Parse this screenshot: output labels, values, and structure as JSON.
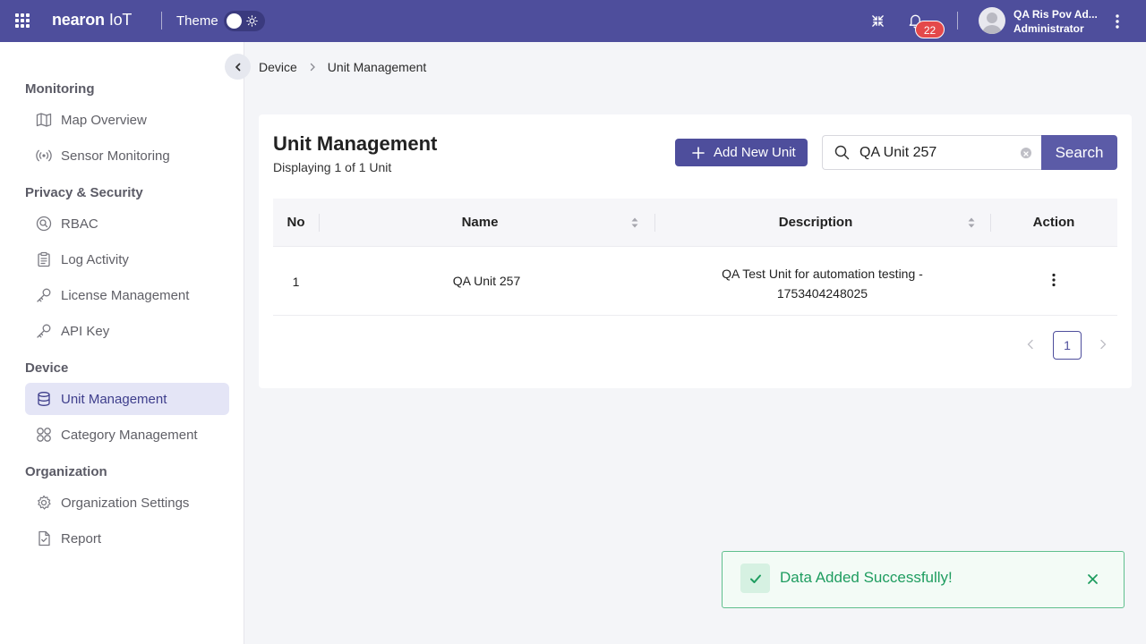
{
  "topbar": {
    "logo_main": "nearon",
    "logo_suffix": "IoT",
    "theme_label": "Theme",
    "notification_count": "22",
    "user_name": "QA Ris Pov Ad...",
    "user_role": "Administrator",
    "brand_color": "#4e4e9c"
  },
  "sidebar": {
    "sections": [
      {
        "title": "Monitoring",
        "items": [
          {
            "label": "Map Overview",
            "icon": "map-icon"
          },
          {
            "label": "Sensor Monitoring",
            "icon": "sensor-icon"
          }
        ]
      },
      {
        "title": "Privacy & Security",
        "items": [
          {
            "label": "RBAC",
            "icon": "rbac-icon"
          },
          {
            "label": "Log Activity",
            "icon": "log-icon"
          },
          {
            "label": "License Management",
            "icon": "key-icon"
          },
          {
            "label": "API Key",
            "icon": "key-icon"
          }
        ]
      },
      {
        "title": "Device",
        "items": [
          {
            "label": "Unit Management",
            "icon": "database-icon",
            "active": true
          },
          {
            "label": "Category Management",
            "icon": "grid-icon"
          }
        ]
      },
      {
        "title": "Organization",
        "items": [
          {
            "label": "Organization Settings",
            "icon": "gear-icon"
          },
          {
            "label": "Report",
            "icon": "report-icon"
          }
        ]
      }
    ]
  },
  "breadcrumb": {
    "parent": "Device",
    "current": "Unit Management"
  },
  "main": {
    "title": "Unit Management",
    "subtitle": "Displaying 1 of 1 Unit",
    "add_button": "Add New Unit",
    "search_value": "QA Unit 257",
    "search_button": "Search",
    "columns": [
      "No",
      "Name",
      "Description",
      "Action"
    ],
    "rows": [
      {
        "no": "1",
        "name": "QA Unit 257",
        "description_line1": "QA Test Unit for automation testing -",
        "description_line2": "1753404248025"
      }
    ],
    "page": "1"
  },
  "toast": {
    "message": "Data Added Successfully!",
    "status_color": "#1f9d60"
  }
}
